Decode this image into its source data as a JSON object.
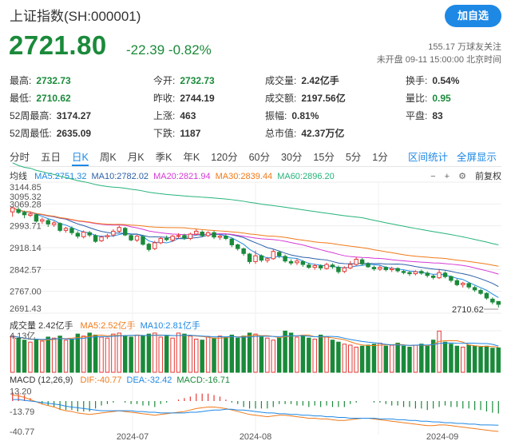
{
  "header": {
    "title": "上证指数(SH:000001)",
    "add_button": "加自选",
    "price": "2721.80",
    "change": "-22.39 -0.82%",
    "followers": "155.17 万球友关注",
    "market_status": "未开盘 09-11 15:00:00 北京时间"
  },
  "stats": [
    {
      "label": "最高:",
      "value": "2732.73",
      "color": "green"
    },
    {
      "label": "今开:",
      "value": "2732.73",
      "color": "green"
    },
    {
      "label": "成交量:",
      "value": "2.42亿手",
      "color": "dark"
    },
    {
      "label": "换手:",
      "value": "0.54%",
      "color": "dark"
    },
    {
      "label": "最低:",
      "value": "2710.62",
      "color": "green"
    },
    {
      "label": "昨收:",
      "value": "2744.19",
      "color": "dark"
    },
    {
      "label": "成交额:",
      "value": "2197.56亿",
      "color": "dark"
    },
    {
      "label": "量比:",
      "value": "0.95",
      "color": "green"
    },
    {
      "label": "52周最高:",
      "value": "3174.27",
      "color": "dark"
    },
    {
      "label": "上涨:",
      "value": "463",
      "color": "dark"
    },
    {
      "label": "振幅:",
      "value": "0.81%",
      "color": "dark"
    },
    {
      "label": "平盘:",
      "value": "83",
      "color": "dark"
    },
    {
      "label": "52周最低:",
      "value": "2635.09",
      "color": "dark"
    },
    {
      "label": "下跌:",
      "value": "1187",
      "color": "dark"
    },
    {
      "label": "总市值:",
      "value": "42.37万亿",
      "color": "dark"
    }
  ],
  "tabs": [
    "分时",
    "五日",
    "日K",
    "周K",
    "月K",
    "季K",
    "年K",
    "120分",
    "60分",
    "30分",
    "15分",
    "5分",
    "1分"
  ],
  "active_tab": "日K",
  "tab_interval": "区间统计",
  "tab_fullscreen": "全屏显示",
  "ma_legend": {
    "label": "均线",
    "items": [
      {
        "text": "MA5:2751.32",
        "color": "#1e88e5"
      },
      {
        "text": "MA10:2782.02",
        "color": "#2c5fa8"
      },
      {
        "text": "MA20:2821.94",
        "color": "#d63ad6"
      },
      {
        "text": "MA30:2839.44",
        "color": "#f07a1a"
      },
      {
        "text": "MA60:2896.20",
        "color": "#26b37a"
      }
    ]
  },
  "ma_controls": {
    "minus": "−",
    "plus": "+",
    "settings": "⚙",
    "adjust": "前复权"
  },
  "vol_legend": {
    "label": "成交量 2.42亿手",
    "items": [
      {
        "text": "MA5:2.52亿手",
        "color": "#f07a1a"
      },
      {
        "text": "MA10:2.81亿手",
        "color": "#1e88e5"
      }
    ]
  },
  "macd_legend": {
    "label": "MACD (12,26,9)",
    "items": [
      {
        "text": "DIF:-40.77",
        "color": "#f07a1a"
      },
      {
        "text": "DEA:-32.42",
        "color": "#1e88e5"
      },
      {
        "text": "MACD:-16.71",
        "color": "#1a8a3a"
      }
    ]
  },
  "chart_data": {
    "type": "candlestick",
    "price_axis": [
      "3144.85",
      "3095.32",
      "3069.28",
      "2993.71",
      "2918.14",
      "2842.57",
      "2767.00",
      "2691.43"
    ],
    "price_ticks_values": [
      3144.85,
      3095.32,
      3069.28,
      2993.71,
      2918.14,
      2842.57,
      2767.0,
      2691.43
    ],
    "ylim": [
      2691.43,
      3144.85
    ],
    "low_label": "2710.62",
    "vol_axis": [
      "4.13亿"
    ],
    "macd_axis": [
      "13.20",
      "-13.79",
      "-40.77"
    ],
    "x_labels": [
      "2024-07",
      "2024-08",
      "2024-09"
    ],
    "candles": [
      [
        3042,
        3056,
        3025,
        3060
      ],
      [
        3050,
        3040,
        3035,
        3058
      ],
      [
        3040,
        3032,
        3020,
        3046
      ],
      [
        3030,
        3035,
        3024,
        3044
      ],
      [
        3032,
        3010,
        3005,
        3036
      ],
      [
        3010,
        3015,
        3000,
        3022
      ],
      [
        3012,
        3000,
        2990,
        3018
      ],
      [
        2998,
        3004,
        2990,
        3010
      ],
      [
        3002,
        2978,
        2972,
        3006
      ],
      [
        2978,
        2985,
        2970,
        2990
      ],
      [
        2985,
        2970,
        2962,
        2992
      ],
      [
        2968,
        2958,
        2950,
        2975
      ],
      [
        2956,
        2972,
        2950,
        2978
      ],
      [
        2970,
        2962,
        2955,
        2976
      ],
      [
        2960,
        2940,
        2935,
        2965
      ],
      [
        2942,
        2955,
        2938,
        2960
      ],
      [
        2956,
        2960,
        2948,
        2966
      ],
      [
        2962,
        2975,
        2955,
        2982
      ],
      [
        2975,
        2988,
        2970,
        2994
      ],
      [
        2985,
        2962,
        2958,
        2990
      ],
      [
        2960,
        2945,
        2940,
        2966
      ],
      [
        2944,
        2958,
        2938,
        2962
      ],
      [
        2956,
        2930,
        2925,
        2962
      ],
      [
        2930,
        2912,
        2905,
        2935
      ],
      [
        2915,
        2935,
        2910,
        2942
      ],
      [
        2935,
        2950,
        2930,
        2955
      ],
      [
        2950,
        2946,
        2940,
        2960
      ],
      [
        2944,
        2958,
        2938,
        2962
      ],
      [
        2958,
        2960,
        2950,
        2968
      ],
      [
        2960,
        2952,
        2945,
        2966
      ],
      [
        2950,
        2965,
        2944,
        2970
      ],
      [
        2965,
        2975,
        2960,
        2982
      ],
      [
        2972,
        2960,
        2955,
        2978
      ],
      [
        2960,
        2970,
        2955,
        2975
      ],
      [
        2970,
        2955,
        2948,
        2976
      ],
      [
        2954,
        2958,
        2945,
        2962
      ],
      [
        2958,
        2950,
        2944,
        2964
      ],
      [
        2948,
        2928,
        2920,
        2952
      ],
      [
        2928,
        2915,
        2908,
        2932
      ],
      [
        2914,
        2898,
        2890,
        2918
      ],
      [
        2896,
        2870,
        2862,
        2900
      ],
      [
        2870,
        2890,
        2862,
        2908
      ],
      [
        2890,
        2875,
        2868,
        2895
      ],
      [
        2874,
        2880,
        2866,
        2886
      ],
      [
        2880,
        2905,
        2876,
        2912
      ],
      [
        2902,
        2890,
        2882,
        2908
      ],
      [
        2888,
        2872,
        2866,
        2894
      ],
      [
        2870,
        2865,
        2858,
        2878
      ],
      [
        2866,
        2872,
        2858,
        2880
      ],
      [
        2870,
        2860,
        2852,
        2875
      ],
      [
        2858,
        2850,
        2845,
        2866
      ],
      [
        2850,
        2856,
        2842,
        2862
      ],
      [
        2855,
        2848,
        2840,
        2860
      ],
      [
        2846,
        2860,
        2842,
        2866
      ],
      [
        2858,
        2852,
        2845,
        2864
      ],
      [
        2850,
        2835,
        2828,
        2856
      ],
      [
        2836,
        2848,
        2830,
        2854
      ],
      [
        2848,
        2860,
        2844,
        2872
      ],
      [
        2860,
        2878,
        2856,
        2885
      ],
      [
        2876,
        2862,
        2856,
        2882
      ],
      [
        2862,
        2852,
        2848,
        2868
      ],
      [
        2850,
        2845,
        2838,
        2856
      ],
      [
        2844,
        2850,
        2838,
        2856
      ],
      [
        2850,
        2842,
        2836,
        2854
      ],
      [
        2842,
        2846,
        2834,
        2852
      ],
      [
        2846,
        2838,
        2832,
        2850
      ],
      [
        2836,
        2832,
        2826,
        2842
      ],
      [
        2832,
        2828,
        2820,
        2838
      ],
      [
        2828,
        2835,
        2822,
        2840
      ],
      [
        2836,
        2830,
        2824,
        2842
      ],
      [
        2830,
        2822,
        2815,
        2836
      ],
      [
        2820,
        2815,
        2808,
        2826
      ],
      [
        2814,
        2832,
        2810,
        2845
      ],
      [
        2830,
        2818,
        2812,
        2836
      ],
      [
        2818,
        2805,
        2798,
        2822
      ],
      [
        2804,
        2790,
        2785,
        2810
      ],
      [
        2790,
        2795,
        2780,
        2800
      ],
      [
        2794,
        2782,
        2775,
        2798
      ],
      [
        2780,
        2772,
        2765,
        2786
      ],
      [
        2770,
        2760,
        2755,
        2776
      ],
      [
        2760,
        2744,
        2738,
        2764
      ],
      [
        2740,
        2730,
        2722,
        2746
      ],
      [
        2732,
        2722,
        2711,
        2733
      ]
    ],
    "volumes": [
      3.6,
      3.4,
      3.2,
      3.0,
      3.3,
      3.1,
      3.5,
      3.4,
      3.6,
      3.2,
      3.3,
      3.8,
      3.6,
      3.9,
      3.7,
      3.5,
      3.4,
      3.8,
      3.9,
      3.6,
      3.5,
      3.7,
      3.6,
      3.8,
      3.9,
      3.5,
      3.6,
      3.4,
      3.9,
      3.8,
      3.6,
      3.3,
      3.2,
      3.5,
      3.4,
      3.6,
      3.5,
      3.7,
      3.4,
      3.6,
      3.9,
      3.8,
      3.5,
      3.4,
      3.2,
      3.4,
      4.1,
      3.9,
      3.5,
      3.6,
      3.4,
      3.3,
      3.7,
      3.5,
      3.2,
      3.0,
      2.8,
      2.7,
      2.5,
      2.6,
      2.7,
      2.8,
      2.9,
      2.6,
      2.7,
      2.9,
      2.6,
      2.5,
      2.7,
      2.8,
      2.6,
      3.2,
      4.1,
      3.0,
      2.8,
      2.6,
      2.5,
      2.7,
      2.6,
      2.5,
      2.6,
      2.4,
      2.42
    ],
    "macd_dif": [
      8,
      7,
      5,
      2,
      -1,
      -4,
      -6,
      -8,
      -11,
      -13,
      -14,
      -16,
      -17,
      -18,
      -17,
      -16,
      -15,
      -14,
      -13,
      -14,
      -15,
      -16,
      -17,
      -18,
      -19,
      -18,
      -17,
      -16,
      -15,
      -14,
      -12,
      -10,
      -9,
      -8,
      -8,
      -9,
      -10,
      -12,
      -14,
      -16,
      -18,
      -19,
      -20,
      -21,
      -20,
      -19,
      -19,
      -20,
      -21,
      -22,
      -23,
      -23,
      -24,
      -24,
      -25,
      -26,
      -26,
      -25,
      -24,
      -23,
      -23,
      -24,
      -25,
      -26,
      -27,
      -28,
      -29,
      -30,
      -31,
      -32,
      -33,
      -33,
      -32,
      -32,
      -33,
      -34,
      -35,
      -36,
      -37,
      -38,
      -39,
      -40,
      -40.77
    ],
    "macd_dea": [
      2,
      2,
      1,
      0,
      -1,
      -2,
      -3,
      -4,
      -5,
      -7,
      -8,
      -9,
      -10,
      -11,
      -12,
      -13,
      -13,
      -13,
      -13,
      -13,
      -13,
      -14,
      -14,
      -15,
      -15,
      -16,
      -16,
      -16,
      -16,
      -16,
      -15,
      -15,
      -14,
      -13,
      -12,
      -12,
      -11,
      -11,
      -12,
      -12,
      -13,
      -14,
      -15,
      -16,
      -16,
      -17,
      -17,
      -18,
      -18,
      -19,
      -19,
      -20,
      -20,
      -21,
      -21,
      -22,
      -22,
      -23,
      -23,
      -23,
      -23,
      -23,
      -24,
      -24,
      -24,
      -25,
      -25,
      -26,
      -26,
      -27,
      -27,
      -28,
      -28,
      -29,
      -29,
      -30,
      -30,
      -31,
      -31,
      -32,
      -32,
      -32.2,
      -32.42
    ]
  }
}
